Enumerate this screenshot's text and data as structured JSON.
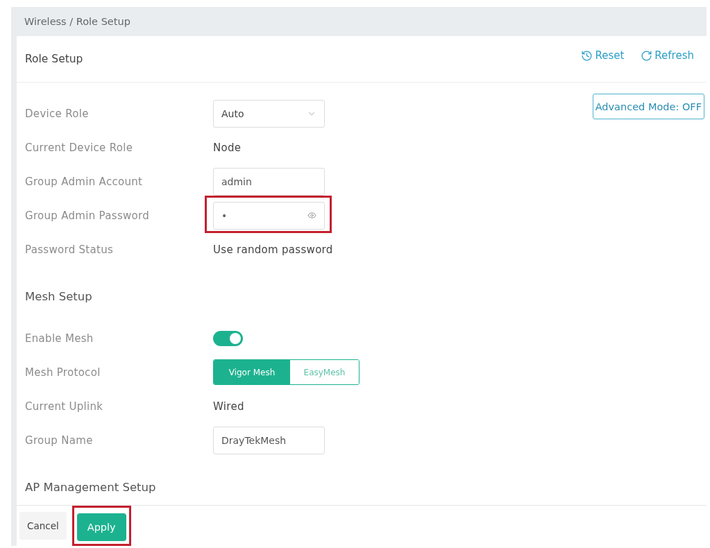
{
  "breadcrumb": "Wireless / Role Setup",
  "panel": {
    "title": "Role Setup",
    "actions": [
      {
        "kind": "reset",
        "label": "Reset"
      },
      {
        "kind": "refresh",
        "label": "Refresh"
      }
    ]
  },
  "advanced_mode_button": {
    "label": "Advanced Mode: OFF"
  },
  "sections": [
    {
      "rows": [
        {
          "label": "Device Role",
          "kind": "select",
          "value": "Auto",
          "highlighted": false
        },
        {
          "label": "Current Device Role",
          "kind": "text",
          "value": "Node",
          "highlighted": false
        },
        {
          "label": "Group Admin Account",
          "kind": "input",
          "value": "admin",
          "highlighted": false
        },
        {
          "label": "Group Admin Password",
          "kind": "password",
          "value": "•",
          "highlighted": true
        },
        {
          "label": "Password Status",
          "kind": "text",
          "value": "Use random password",
          "highlighted": false
        }
      ]
    },
    {
      "title": "Mesh Setup",
      "rows": [
        {
          "label": "Enable Mesh",
          "kind": "toggle",
          "on": true,
          "highlighted": false
        },
        {
          "label": "Mesh Protocol",
          "kind": "segmented",
          "options": [
            {
              "label": "Vigor Mesh",
              "selected": true
            },
            {
              "label": "EasyMesh",
              "selected": false
            }
          ],
          "highlighted": false
        },
        {
          "label": "Current Uplink",
          "kind": "text",
          "value": "Wired",
          "highlighted": false
        },
        {
          "label": "Group Name",
          "kind": "input",
          "value": "DrayTekMesh",
          "highlighted": false
        }
      ]
    },
    {
      "title": "AP Management Setup"
    }
  ],
  "footer_buttons": [
    {
      "label": "Cancel",
      "kind": "secondary",
      "highlighted": false
    },
    {
      "label": "Apply",
      "kind": "primary",
      "highlighted": true
    }
  ]
}
